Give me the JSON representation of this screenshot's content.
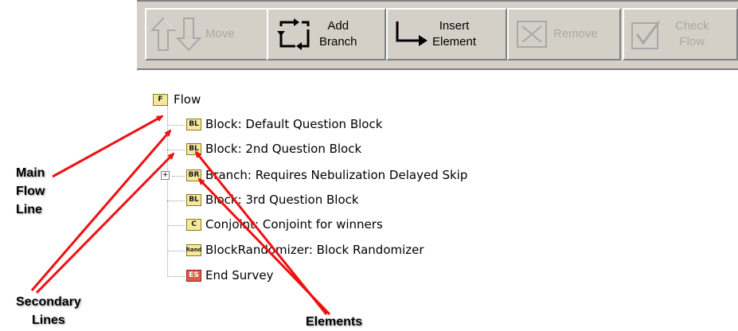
{
  "toolbar": {
    "move": {
      "label": "Move",
      "enabled": false
    },
    "add_branch": {
      "label_line1": "Add",
      "label_line2": "Branch",
      "enabled": true
    },
    "insert_element": {
      "label_line1": "Insert",
      "label_line2": "Element",
      "enabled": true
    },
    "remove": {
      "label": "Remove",
      "enabled": false
    },
    "check_flow": {
      "label_line1": "Check",
      "label_line2": "Flow",
      "enabled": false
    }
  },
  "tree": {
    "root": {
      "icon_text": "F",
      "label": "Flow"
    },
    "items": [
      {
        "icon_text": "BL",
        "label": "Block: Default Question Block"
      },
      {
        "icon_text": "BL",
        "label": "Block: 2nd Question Block"
      },
      {
        "icon_text": "BR",
        "label": "Branch: Requires Nebulization Delayed Skip",
        "collapsed": true
      },
      {
        "icon_text": "BL",
        "label": "Block: 3rd Question Block"
      },
      {
        "icon_text": "C",
        "label": "Conjoint: Conjoint for winners"
      },
      {
        "icon_text": "Rand",
        "label": "BlockRandomizer: Block Randomizer"
      },
      {
        "icon_text": "ES",
        "label": "End Survey"
      }
    ],
    "expander_symbol": "+"
  },
  "annotations": {
    "main_flow_line": {
      "line1": "Main",
      "line2": "Flow",
      "line3": "Line"
    },
    "secondary_lines": {
      "line1": "Secondary",
      "line2": "Lines"
    },
    "elements": {
      "line1": "Elements"
    },
    "arrow_color": "#ee1111"
  },
  "colors": {
    "toolbar_bg": "#d4d0c8",
    "folder_fill": "#f4e99a",
    "end_survey_fill": "#e05a4a"
  }
}
